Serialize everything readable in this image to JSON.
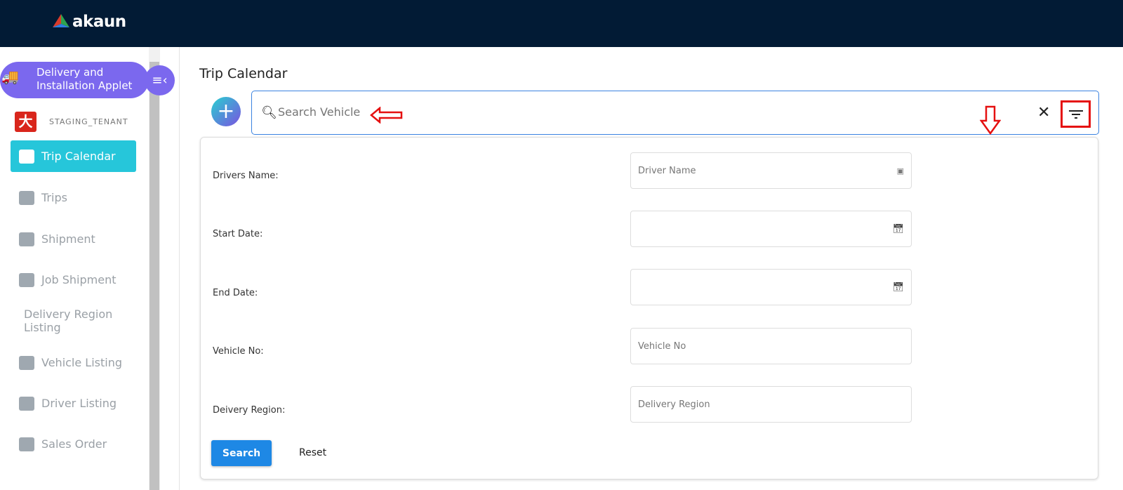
{
  "header": {
    "logo_text": "akaun"
  },
  "sidebar": {
    "applet_title": "Delivery and Installation Applet",
    "tenant": "STAGING_TENANT",
    "items": [
      {
        "label": "Trip Calendar",
        "icon": "calendar-icon",
        "active": true
      },
      {
        "label": "Trips",
        "icon": "map-icon"
      },
      {
        "label": "Shipment",
        "icon": "ship-icon"
      },
      {
        "label": "Job Shipment",
        "icon": "ship-icon"
      },
      {
        "label": "Delivery Region Listing",
        "icon": ""
      },
      {
        "label": "Vehicle Listing",
        "icon": "truck-icon"
      },
      {
        "label": "Driver Listing",
        "icon": "badge-icon"
      },
      {
        "label": "Sales Order",
        "icon": "ship-icon"
      }
    ]
  },
  "main": {
    "title": "Trip Calendar",
    "search_placeholder": "Search Vehicle",
    "filters": [
      {
        "label": "Drivers Name:",
        "placeholder": "Driver Name",
        "icon": "contact-icon"
      },
      {
        "label": "Start Date:",
        "placeholder": "",
        "icon": "calendar-icon"
      },
      {
        "label": "End Date:",
        "placeholder": "",
        "icon": "calendar-icon"
      },
      {
        "label": "Vehicle No:",
        "placeholder": "Vehicle No",
        "icon": ""
      },
      {
        "label": "Deivery Region:",
        "placeholder": "Delivery Region",
        "icon": ""
      }
    ],
    "search_label": "Search",
    "reset_label": "Reset"
  },
  "colors": {
    "header": "#021b35",
    "accent": "#26c6da",
    "applet": "#7b68ee",
    "primary": "#1e88e5",
    "annotation": "#e51010"
  }
}
